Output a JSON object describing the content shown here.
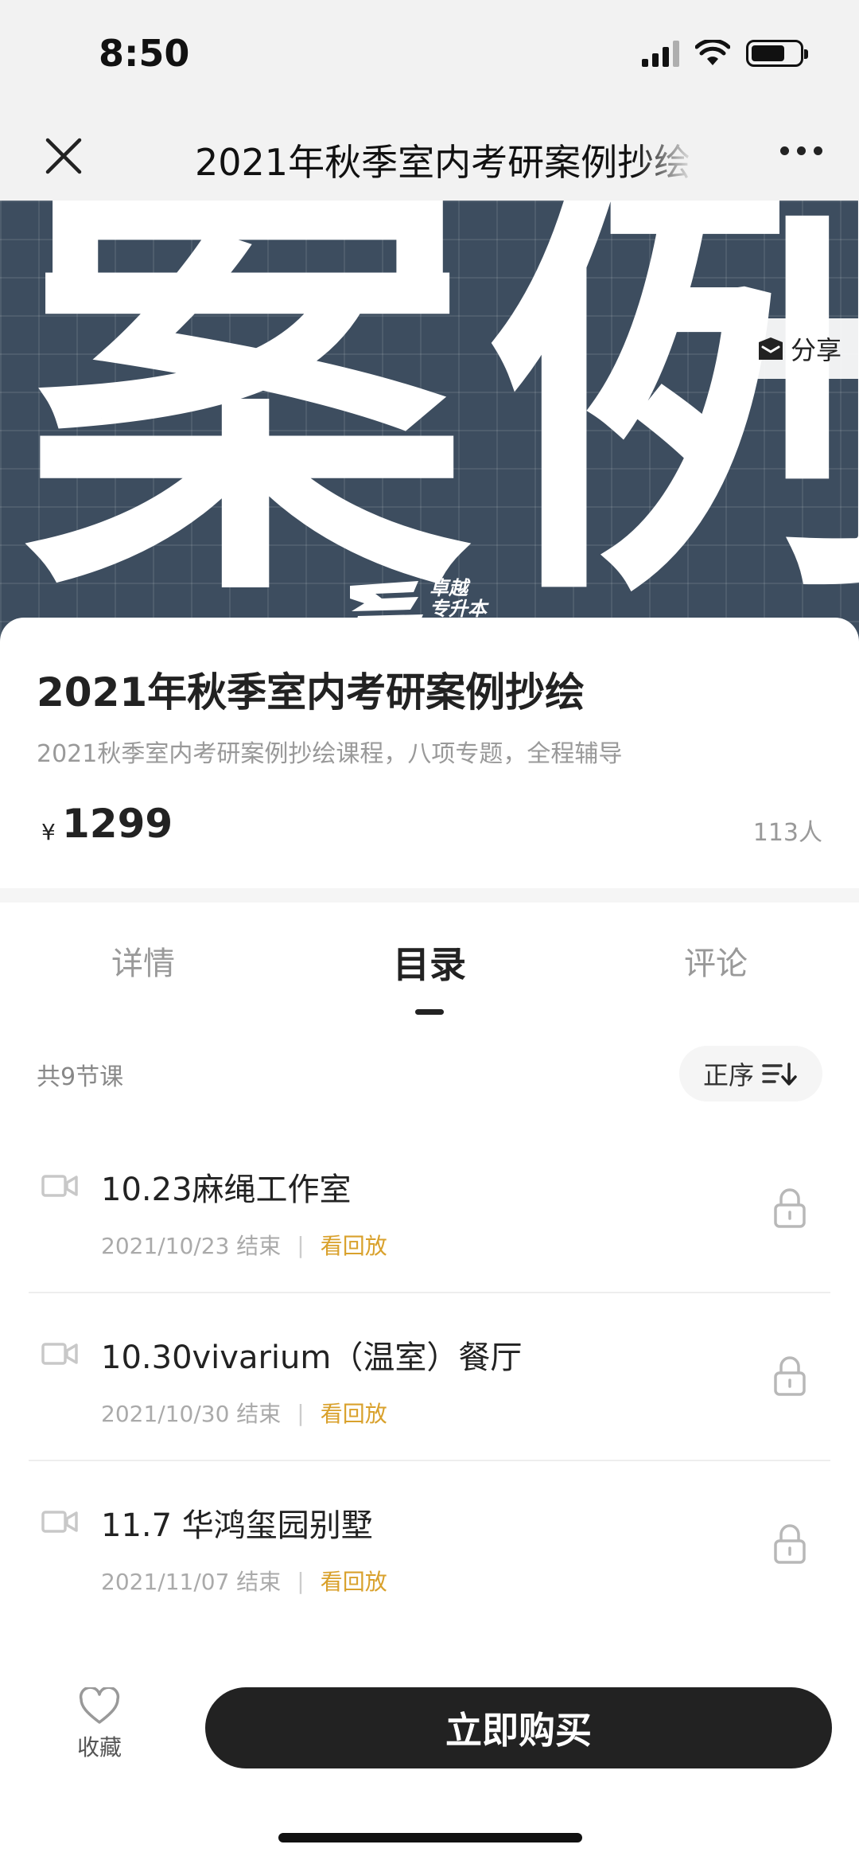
{
  "status_bar": {
    "time": "8:50"
  },
  "nav": {
    "title": "2021年秋季室内考研案例抄绘"
  },
  "banner": {
    "chars": "案例",
    "logo_text_line1": "卓越",
    "logo_text_line2": "专升本",
    "share_label": "分享"
  },
  "product": {
    "title": "2021年秋季室内考研案例抄绘",
    "subtitle": "2021秋季室内考研案例抄绘课程，八项专题，全程辅导",
    "currency": "¥",
    "price": "1299",
    "enrolled": "113人"
  },
  "tabs": [
    {
      "label": "详情"
    },
    {
      "label": "目录",
      "active": true
    },
    {
      "label": "评论"
    }
  ],
  "catalog": {
    "count_label": "共9节课",
    "sort_label": "正序",
    "lessons": [
      {
        "title": "10.23麻绳工作室",
        "date": "2021/10/23 结束",
        "separator": "|",
        "action": "看回放",
        "locked": true
      },
      {
        "title": "10.30vivarium（温室）餐厅",
        "date": "2021/10/30 结束",
        "separator": "|",
        "action": "看回放",
        "locked": true
      },
      {
        "title": "11.7 华鸿玺园别墅",
        "date": "2021/11/07 结束",
        "separator": "|",
        "action": "看回放",
        "locked": true
      }
    ]
  },
  "bottom": {
    "favorite_label": "收藏",
    "buy_label": "立即购买"
  },
  "colors": {
    "accent": "#d9a12c",
    "buy_button": "#222222",
    "banner_bg": "#3d4d5f"
  }
}
